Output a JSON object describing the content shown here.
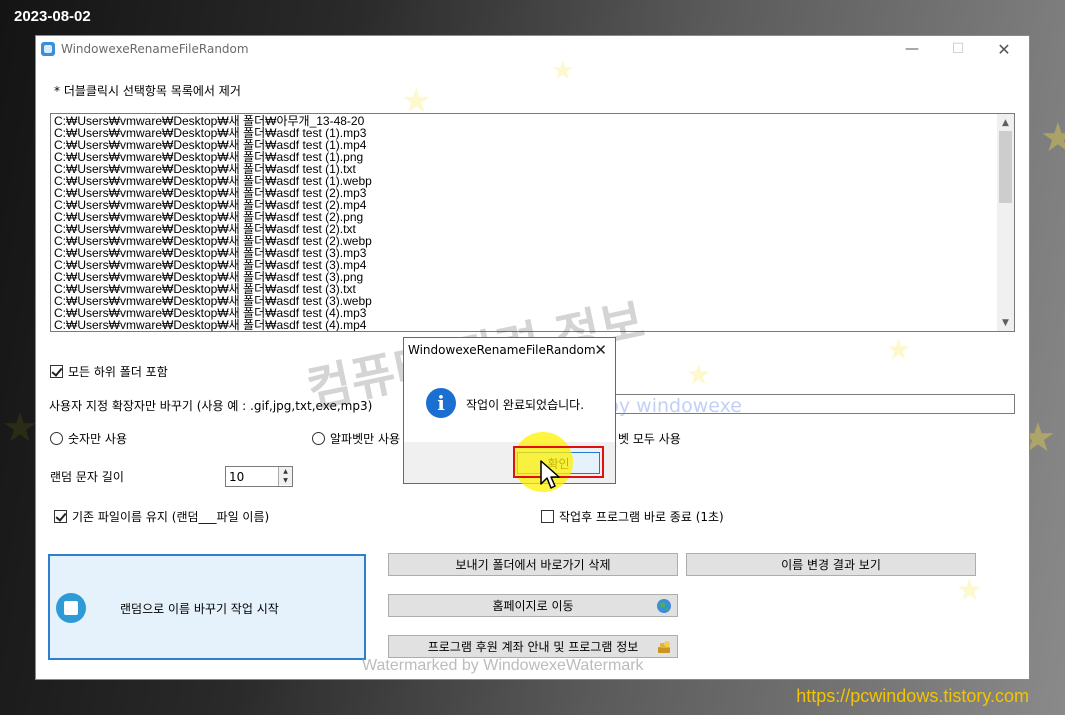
{
  "date_stamp": "2023-08-02",
  "site_url": "https://pcwindows.tistory.com",
  "window": {
    "title": "WindowexeRenameFileRandom",
    "min_glyph": "—",
    "max_glyph": "☐",
    "close_glyph": "✕"
  },
  "hint_text": "* 더블클릭시 선택항목 목록에서 제거",
  "file_list": [
    "C:₩Users₩vmware₩Desktop₩새 폴더₩아무개_13-48-20",
    "C:₩Users₩vmware₩Desktop₩새 폴더₩asdf test (1).mp3",
    "C:₩Users₩vmware₩Desktop₩새 폴더₩asdf test (1).mp4",
    "C:₩Users₩vmware₩Desktop₩새 폴더₩asdf test (1).png",
    "C:₩Users₩vmware₩Desktop₩새 폴더₩asdf test (1).txt",
    "C:₩Users₩vmware₩Desktop₩새 폴더₩asdf test (1).webp",
    "C:₩Users₩vmware₩Desktop₩새 폴더₩asdf test (2).mp3",
    "C:₩Users₩vmware₩Desktop₩새 폴더₩asdf test (2).mp4",
    "C:₩Users₩vmware₩Desktop₩새 폴더₩asdf test (2).png",
    "C:₩Users₩vmware₩Desktop₩새 폴더₩asdf test (2).txt",
    "C:₩Users₩vmware₩Desktop₩새 폴더₩asdf test (2).webp",
    "C:₩Users₩vmware₩Desktop₩새 폴더₩asdf test (3).mp3",
    "C:₩Users₩vmware₩Desktop₩새 폴더₩asdf test (3).mp4",
    "C:₩Users₩vmware₩Desktop₩새 폴더₩asdf test (3).png",
    "C:₩Users₩vmware₩Desktop₩새 폴더₩asdf test (3).txt",
    "C:₩Users₩vmware₩Desktop₩새 폴더₩asdf test (3).webp",
    "C:₩Users₩vmware₩Desktop₩새 폴더₩asdf test (4).mp3",
    "C:₩Users₩vmware₩Desktop₩새 폴더₩asdf test (4).mp4"
  ],
  "options": {
    "include_subfolders_label": "모든 하위 폴더 포함",
    "include_subfolders_checked": true,
    "custom_ext_label": "사용자 지정 확장자만 바꾸기 (사용 예 : .gif,jpg,txt,exe,mp3)",
    "custom_ext_value": "",
    "radio_numbers_label": "숫자만 사용",
    "radio_alpha_label": "알파벳만 사용",
    "radio_both_label": "벳 모두 사용",
    "random_length_label": "랜덤 문자 길이",
    "random_length_value": "10",
    "keep_name_label": "기존 파일이름 유지 (랜덤___파일 이름)",
    "keep_name_checked": true,
    "exit_after_label": "작업후 프로그램 바로 종료 (1초)",
    "exit_after_checked": false
  },
  "buttons": {
    "start": "랜덤으로 이름 바꾸기 작업 시작",
    "delete_shortcut": "보내기 폴더에서 바로가기 삭제",
    "view_results": "이름 변경 결과 보기",
    "homepage": "홈페이지로 이동",
    "donate_info": "프로그램 후원 계좌 안내 및 프로그램 정보"
  },
  "dialog": {
    "title": "WindowexeRenameFileRandom",
    "message": "작업이 완료되었습니다.",
    "ok_label": "확인",
    "close_glyph": "✕"
  },
  "watermarks": {
    "big": "컴퓨터 관련 정보",
    "blue": "Watermark by windowexe",
    "bottom": "Watermarked by WindowexeWatermark"
  },
  "colors": {
    "accent_blue": "#1f79d3",
    "highlight_yellow": "#fff000",
    "red_box": "#e01010",
    "url_yellow": "#f5c400"
  }
}
